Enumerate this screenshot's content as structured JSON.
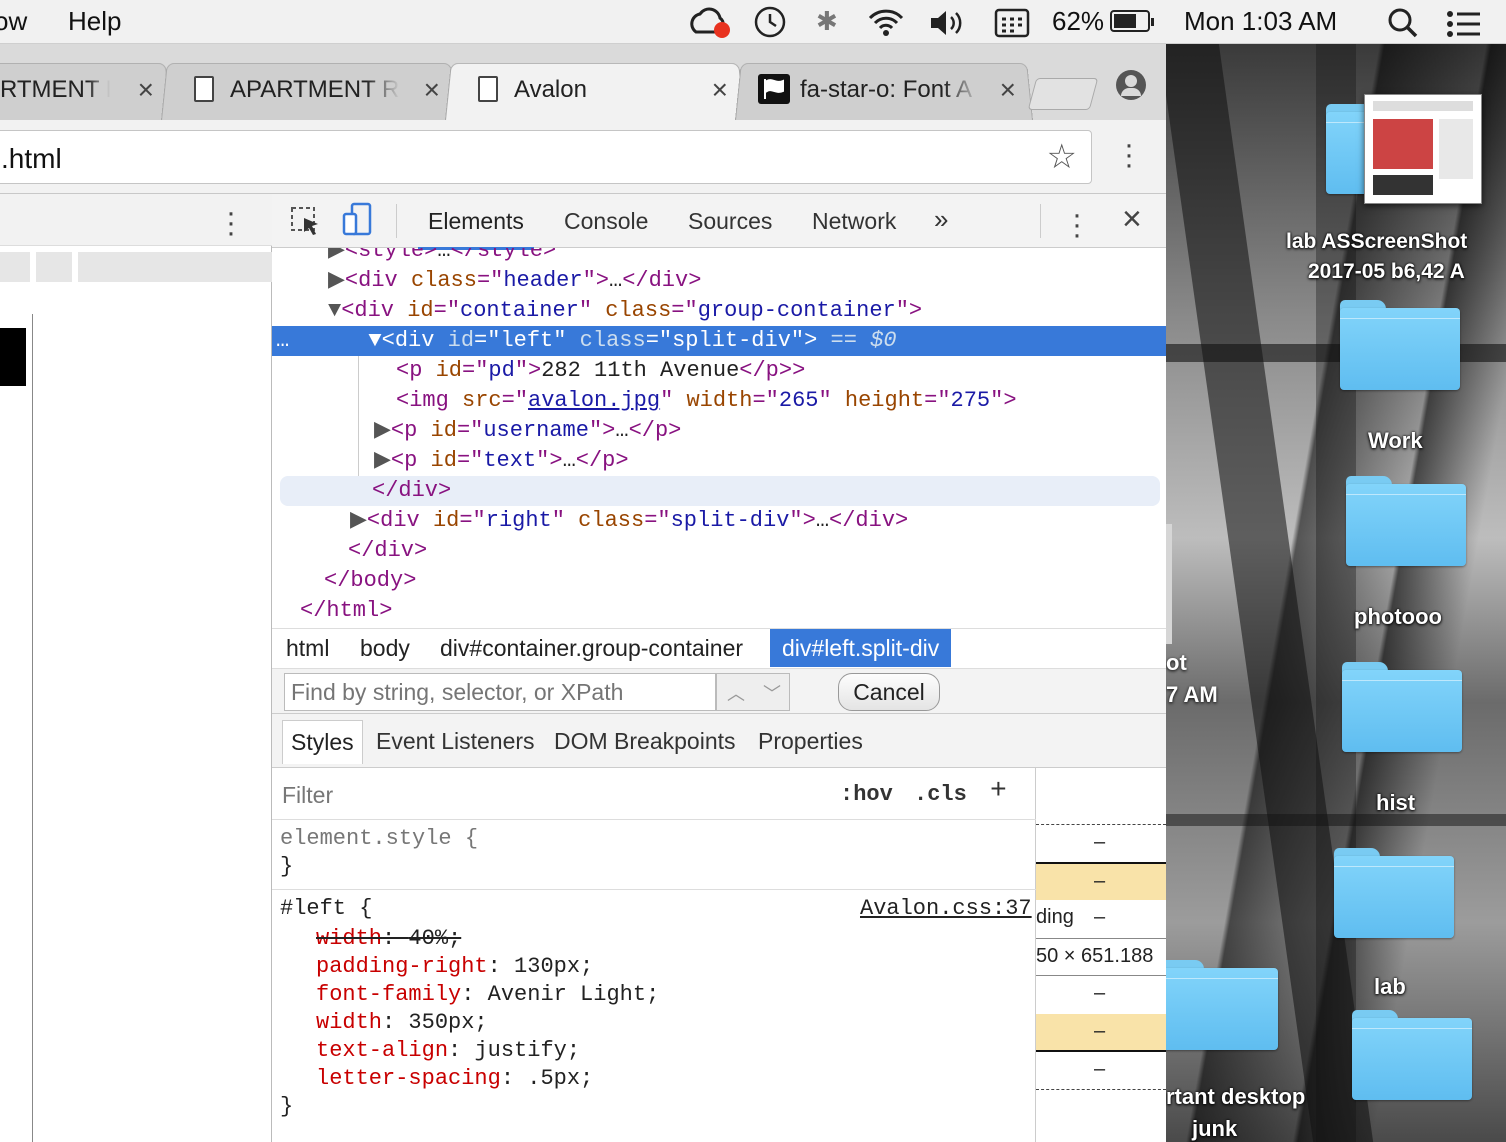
{
  "menubar": {
    "app_menu_partial": "ow",
    "help": "Help",
    "battery_pct": "62%",
    "clock": "Mon 1:03 AM"
  },
  "browser": {
    "tabs": [
      {
        "title": "RTMENT RE"
      },
      {
        "title": "APARTMENT RE"
      },
      {
        "title": "Avalon"
      },
      {
        "title": "fa-star-o: Font A"
      }
    ],
    "address": ".html"
  },
  "devtools": {
    "tabs": [
      "Elements",
      "Console",
      "Sources",
      "Network"
    ],
    "more_tabs": "»",
    "dom": {
      "l0": {
        "tag": "<style>",
        "ell": "…",
        "close": "</style>"
      },
      "l1": {
        "open": "<div",
        "attr": "class",
        "val": "header",
        "ell": "…",
        "close": "</div>"
      },
      "l2": {
        "open": "<div",
        "a1": "id",
        "v1": "container",
        "a2": "class",
        "v2": "group-container"
      },
      "l3": {
        "open": "<div",
        "a1": "id",
        "v1": "left",
        "a2": "class",
        "v2": "split-div",
        "marker": "== $0",
        "dots": "…"
      },
      "l4": {
        "open": "<p",
        "attr": "id",
        "val": "pd",
        "text": "282 11th Avenue",
        "close": "</p>"
      },
      "l5": {
        "open": "<img",
        "a1": "src",
        "v1": "avalon.jpg",
        "a2": "width",
        "v2": "265",
        "a3": "height",
        "v3": "275"
      },
      "l6": {
        "open": "<p",
        "attr": "id",
        "val": "username",
        "ell": "…",
        "close": "</p>"
      },
      "l7": {
        "open": "<p",
        "attr": "id",
        "val": "text",
        "ell": "…",
        "close": "</p>"
      },
      "l8": "</div>",
      "l9": {
        "open": "<div",
        "a1": "id",
        "v1": "right",
        "a2": "class",
        "v2": "split-div",
        "ell": "…",
        "close": "</div>"
      },
      "l10": "</div>",
      "l11": "</body>",
      "l12": "</html>"
    },
    "breadcrumbs": [
      "html",
      "body",
      "div#container.group-container",
      "div#left.split-div"
    ],
    "find": {
      "placeholder": "Find by string, selector, or XPath",
      "cancel": "Cancel"
    },
    "subtabs": [
      "Styles",
      "Event Listeners",
      "DOM Breakpoints",
      "Properties"
    ],
    "styles": {
      "filter_placeholder": "Filter",
      "hov": ":hov",
      "cls": ".cls",
      "plus": "+",
      "element_style": "element.style {",
      "close_brace": "}",
      "rule_selector": "#left {",
      "rule_source": "Avalon.css:37",
      "props": [
        {
          "name": "width",
          "value": "40%;",
          "overridden": true
        },
        {
          "name": "padding-right",
          "value": "130px;"
        },
        {
          "name": "font-family",
          "value": "Avenir Light;"
        },
        {
          "name": "width",
          "value": "350px;"
        },
        {
          "name": "text-align",
          "value": "justify;"
        },
        {
          "name": "letter-spacing",
          "value": ".5px;"
        }
      ]
    },
    "boxmodel": {
      "dash": "–",
      "padding_label": "ding",
      "size": "50 × 651.188"
    }
  },
  "desktop": {
    "items": [
      "Work",
      "photooo",
      "hist",
      "lab"
    ],
    "screenshot_label": "lab ASScreenShot",
    "screenshot_date": "2017-05 b6,42 A",
    "peek_1": "ot",
    "peek_2": "7 AM",
    "junk_1": "rtant desktop",
    "junk_2": "junk"
  }
}
